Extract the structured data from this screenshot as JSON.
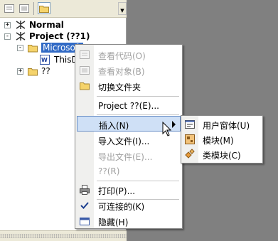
{
  "explorer": {
    "tree": [
      {
        "label": "Normal",
        "expander": "+"
      },
      {
        "label": "Project (??1)",
        "expander": "-"
      },
      {
        "label": "Microsoft",
        "expander": "-"
      },
      {
        "label": "ThisD"
      },
      {
        "label": "??",
        "expander": "+"
      }
    ]
  },
  "context_menu": {
    "items": [
      {
        "label": "查看代码(O)",
        "disabled": true
      },
      {
        "label": "查看对象(B)",
        "disabled": true
      },
      {
        "label": "切换文件夹"
      },
      {
        "label": "Project ??(E)..."
      },
      {
        "label": "插入(N)",
        "highlighted": true,
        "has_submenu": true
      },
      {
        "label": "导入文件(I)..."
      },
      {
        "label": "导出文件(E)...",
        "disabled": true
      },
      {
        "label": "??(R)",
        "disabled": true
      },
      {
        "label": "打印(P)..."
      },
      {
        "label": "可连接的(K)",
        "checked": true
      },
      {
        "label": "隐藏(H)"
      }
    ]
  },
  "submenu": {
    "items": [
      {
        "label": "用户窗体(U)"
      },
      {
        "label": "模块(M)"
      },
      {
        "label": "类模块(C)"
      }
    ]
  },
  "colors": {
    "selection": "#316ac5",
    "menu_hover": "#cfe0f6",
    "background": "#808080"
  }
}
